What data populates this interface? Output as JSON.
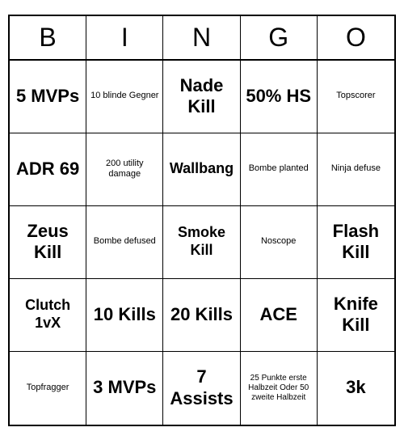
{
  "header": {
    "letters": [
      "B",
      "I",
      "N",
      "G",
      "O"
    ]
  },
  "cells": [
    {
      "text": "5 MVPs",
      "size": "large"
    },
    {
      "text": "10 blinde Gegner",
      "size": "small"
    },
    {
      "text": "Nade Kill",
      "size": "large"
    },
    {
      "text": "50% HS",
      "size": "large"
    },
    {
      "text": "Topscorer",
      "size": "small"
    },
    {
      "text": "ADR 69",
      "size": "large"
    },
    {
      "text": "200 utility damage",
      "size": "small"
    },
    {
      "text": "Wallbang",
      "size": "medium"
    },
    {
      "text": "Bombe planted",
      "size": "small"
    },
    {
      "text": "Ninja defuse",
      "size": "small"
    },
    {
      "text": "Zeus Kill",
      "size": "large"
    },
    {
      "text": "Bombe defused",
      "size": "small"
    },
    {
      "text": "Smoke Kill",
      "size": "medium"
    },
    {
      "text": "Noscope",
      "size": "small"
    },
    {
      "text": "Flash Kill",
      "size": "large"
    },
    {
      "text": "Clutch 1vX",
      "size": "medium"
    },
    {
      "text": "10 Kills",
      "size": "large"
    },
    {
      "text": "20 Kills",
      "size": "large"
    },
    {
      "text": "ACE",
      "size": "large"
    },
    {
      "text": "Knife Kill",
      "size": "large"
    },
    {
      "text": "Topfragger",
      "size": "small"
    },
    {
      "text": "3 MVPs",
      "size": "large"
    },
    {
      "text": "7 Assists",
      "size": "large"
    },
    {
      "text": "25 Punkte erste Halbzeit Oder 50 zweite Halbzeit",
      "size": "tiny"
    },
    {
      "text": "3k",
      "size": "large"
    }
  ]
}
